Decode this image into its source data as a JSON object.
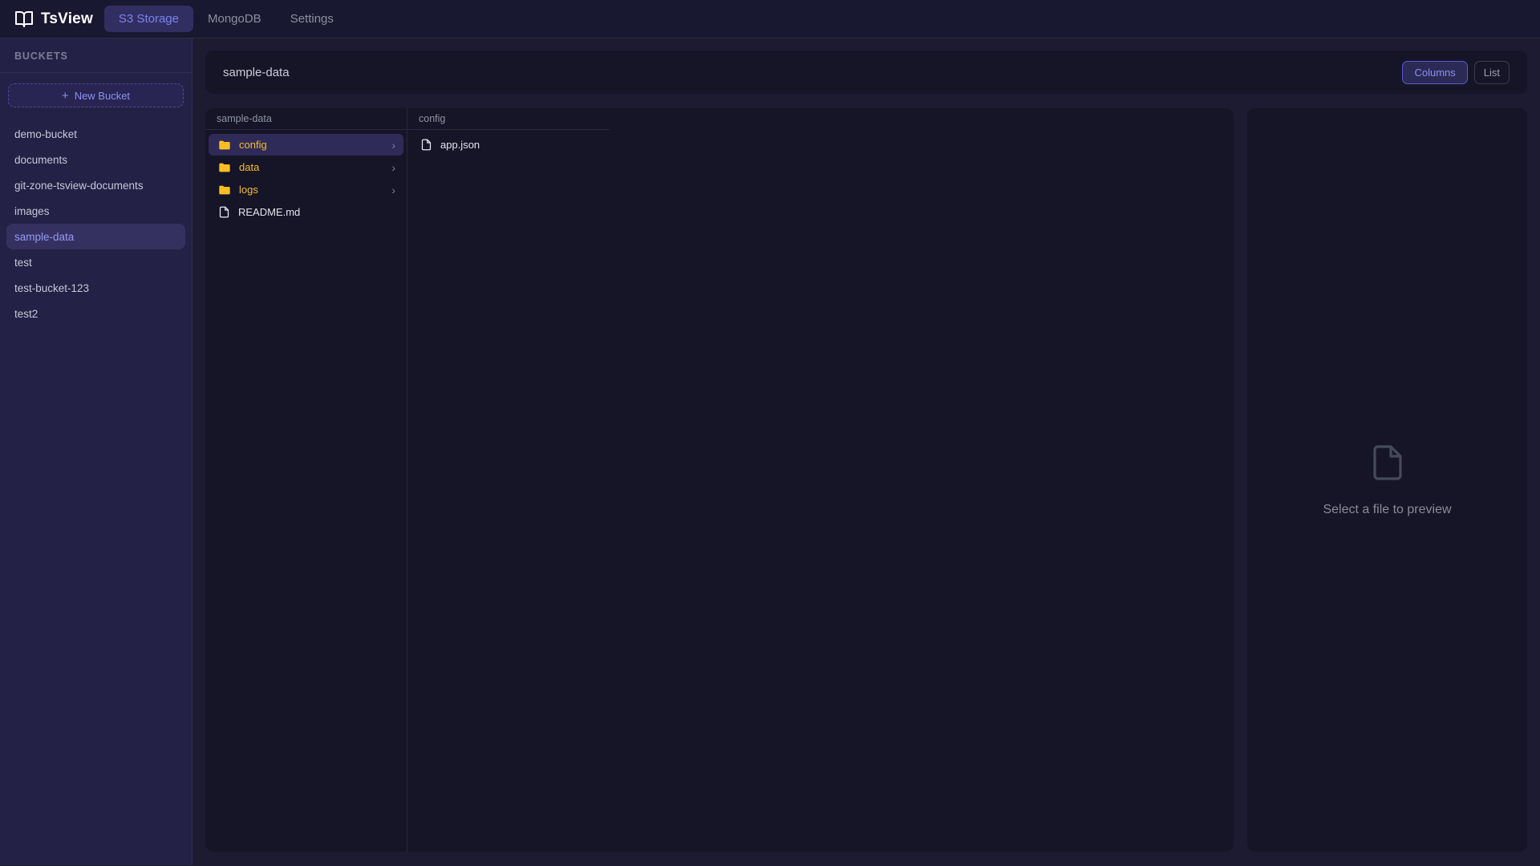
{
  "app": {
    "title": "TsView"
  },
  "nav": {
    "items": [
      {
        "label": "S3 Storage",
        "active": true
      },
      {
        "label": "MongoDB",
        "active": false
      },
      {
        "label": "Settings",
        "active": false
      }
    ]
  },
  "sidebar": {
    "section_title": "BUCKETS",
    "new_bucket_label": "New Bucket",
    "buckets": [
      "demo-bucket",
      "documents",
      "git-zone-tsview-documents",
      "images",
      "sample-data",
      "test",
      "test-bucket-123",
      "test2"
    ],
    "selected_bucket": "sample-data"
  },
  "main": {
    "title": "sample-data",
    "view_buttons": {
      "columns": "Columns",
      "list": "List",
      "active": "Columns"
    },
    "columns": [
      {
        "header": "sample-data",
        "items": [
          {
            "name": "config",
            "type": "folder",
            "selected": true
          },
          {
            "name": "data",
            "type": "folder",
            "selected": false
          },
          {
            "name": "logs",
            "type": "folder",
            "selected": false
          },
          {
            "name": "README.md",
            "type": "file",
            "selected": false
          }
        ]
      },
      {
        "header": "config",
        "items": [
          {
            "name": "app.json",
            "type": "file",
            "selected": false
          }
        ]
      }
    ],
    "preview": {
      "placeholder": "Select a file to preview"
    }
  },
  "icons": {
    "plus": "+",
    "chevron": "›"
  },
  "colors": {
    "accent": "#7d82ee",
    "folder_yellow": "#fbbf24",
    "selection_bg": "#2e2b58",
    "sidebar_bg": "#242147",
    "card_bg": "#161527",
    "topbar_bg": "#181830",
    "page_bg": "#1c1b31"
  }
}
